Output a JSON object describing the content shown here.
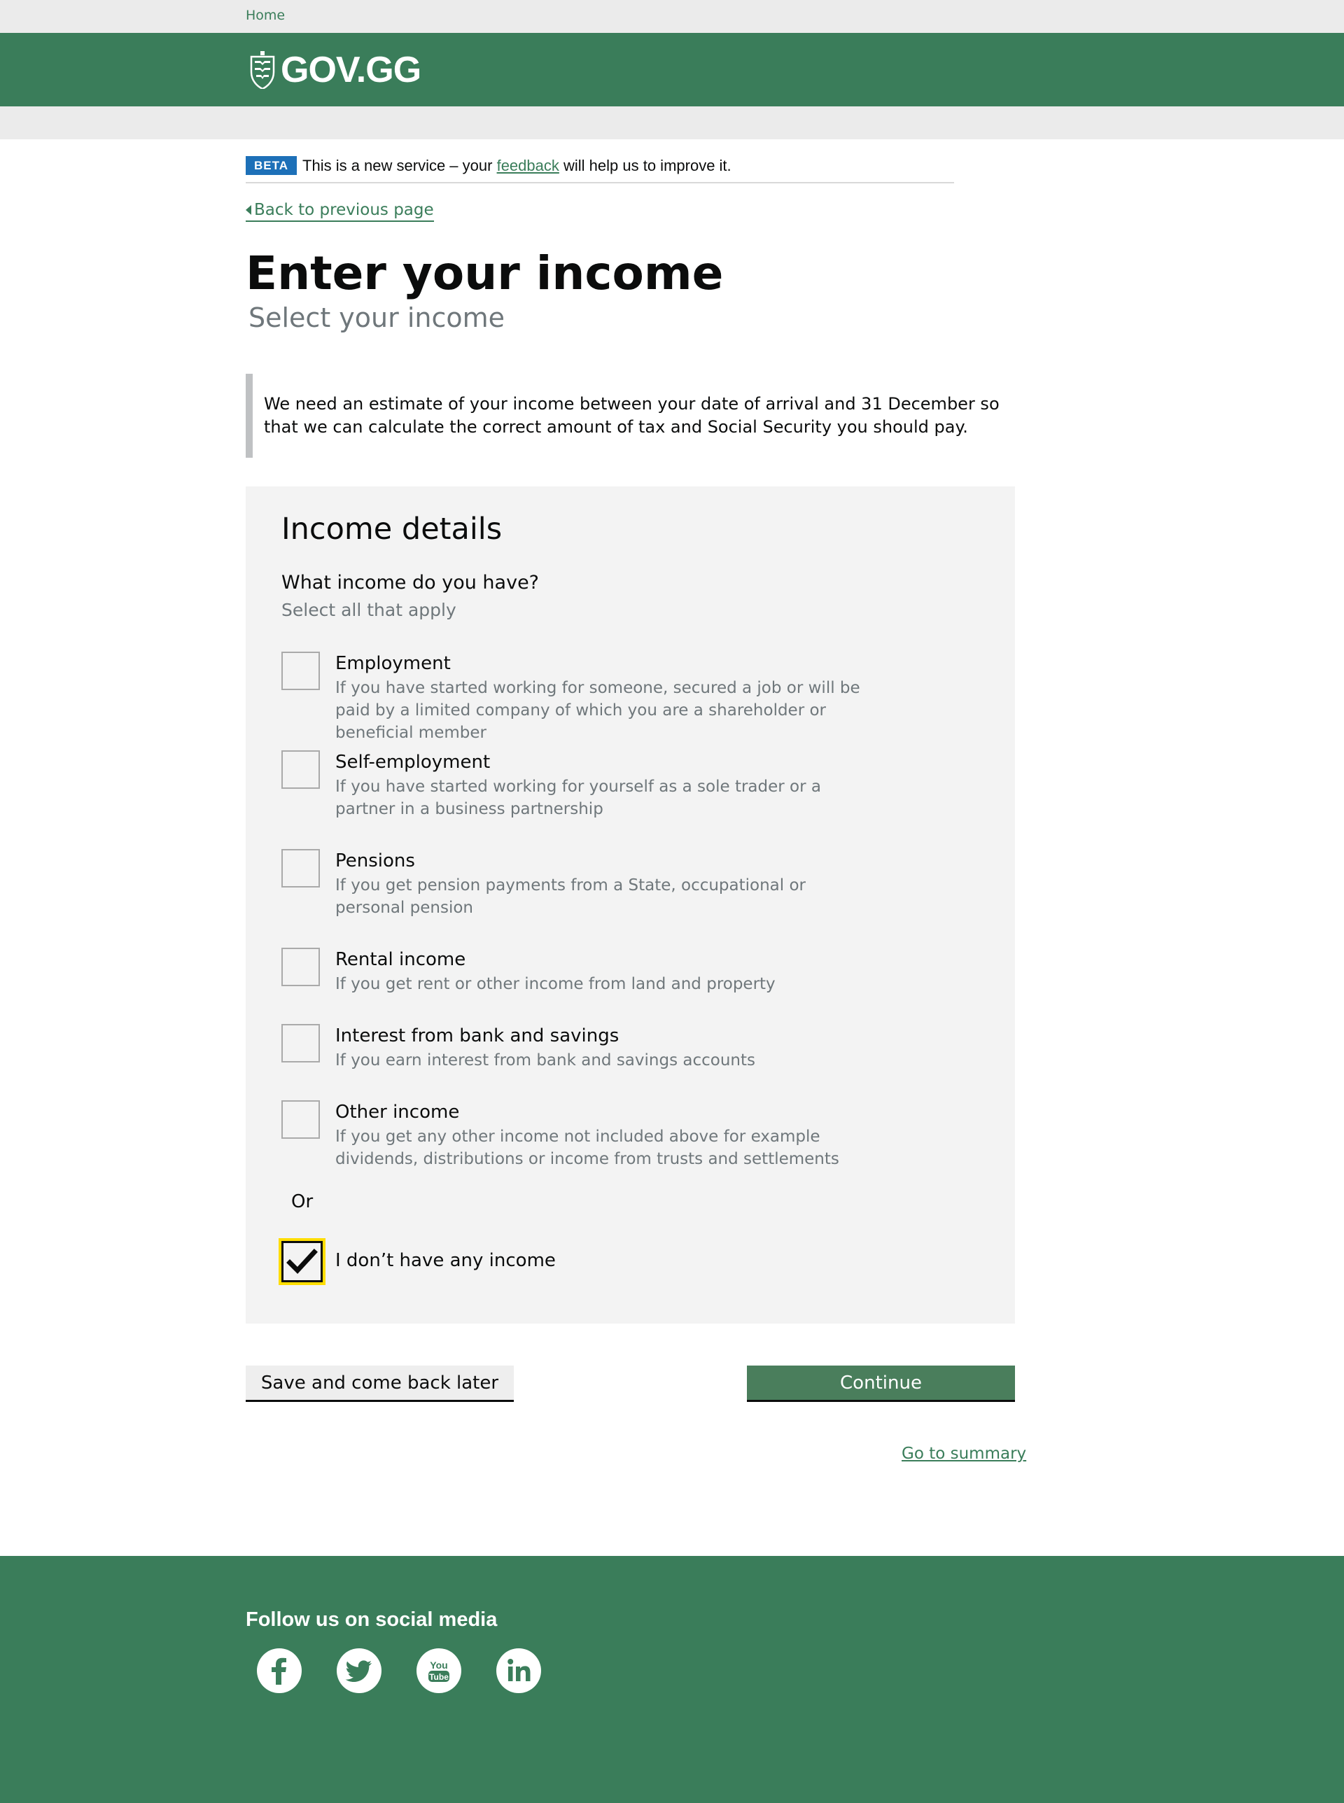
{
  "topbar": {
    "home_label": "Home"
  },
  "header": {
    "logo_text": "GOV.GG"
  },
  "beta": {
    "tag": "BETA",
    "text_before": "This is a new service – your",
    "link": "feedback",
    "text_after": "will help us to improve it."
  },
  "nav": {
    "back_label": "Back to previous page"
  },
  "page": {
    "title": "Enter your income",
    "subtitle": "Select your income",
    "inset_text": "We need an estimate of your income between your date of arrival and 31 December so that we can calculate the correct amount of tax and Social Security you should pay."
  },
  "panel": {
    "heading": "Income details",
    "question": "What income do you have?",
    "hint": "Select all that apply",
    "options": [
      {
        "label": "Employment",
        "hint": "If you have started working for someone, secured a job or will be paid by a limited company of which you are a shareholder or beneficial member",
        "checked": false
      },
      {
        "label": "Self-employment",
        "hint": "If you have started working for yourself as a sole trader or a partner in a business partnership",
        "checked": false
      },
      {
        "label": "Pensions",
        "hint": "If you get pension payments from a State, occupational or personal pension",
        "checked": false
      },
      {
        "label": "Rental income",
        "hint": "If you get rent or other income from land and property",
        "checked": false
      },
      {
        "label": "Interest from bank and savings",
        "hint": "If you earn interest from bank and savings accounts",
        "checked": false
      },
      {
        "label": "Other income",
        "hint": "If you get any other income not included above for example dividends, distributions or income from trusts and settlements",
        "checked": false
      }
    ],
    "or_label": "Or",
    "none_option": {
      "label": "I don’t have any income",
      "checked": true
    }
  },
  "actions": {
    "save_label": "Save and come back later",
    "continue_label": "Continue",
    "summary_label": "Go to summary"
  },
  "footer": {
    "heading": "Follow us on social media",
    "social": [
      "facebook-icon",
      "twitter-icon",
      "youtube-icon",
      "linkedin-icon"
    ]
  },
  "colors": {
    "brand_green": "#3a7d5a",
    "continue_green": "#4a7e5c",
    "beta_blue": "#1d70b8",
    "focus_yellow": "#ffdd00"
  }
}
